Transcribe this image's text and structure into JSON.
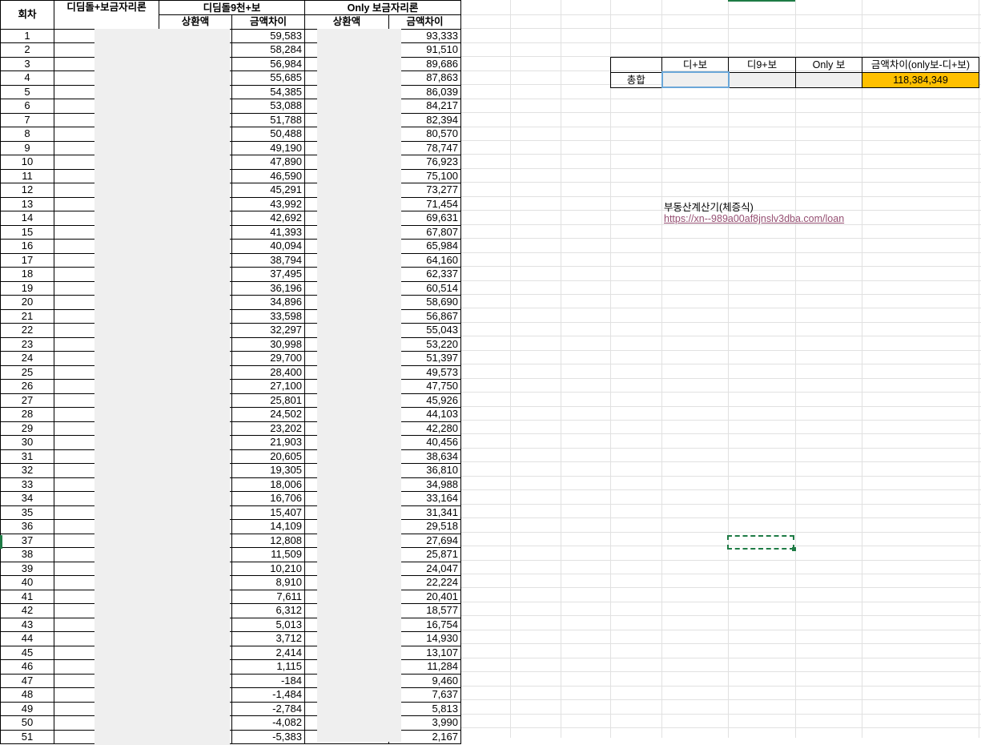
{
  "table": {
    "headers": {
      "round": "회차",
      "didimdol_bogeum": "디딤돌+보금자리론",
      "didimdol9_group": "디딤돌9천+보",
      "only_group": "Only 보금자리론",
      "repay": "상환액",
      "diff": "금액차이",
      "repay2": "상환액",
      "diff2": "금액차이"
    },
    "rows": [
      {
        "n": "1",
        "d": "59,583",
        "o": "93,333"
      },
      {
        "n": "2",
        "d": "58,284",
        "o": "91,510"
      },
      {
        "n": "3",
        "d": "56,984",
        "o": "89,686"
      },
      {
        "n": "4",
        "d": "55,685",
        "o": "87,863"
      },
      {
        "n": "5",
        "d": "54,385",
        "o": "86,039"
      },
      {
        "n": "6",
        "d": "53,088",
        "o": "84,217"
      },
      {
        "n": "7",
        "d": "51,788",
        "o": "82,394"
      },
      {
        "n": "8",
        "d": "50,488",
        "o": "80,570"
      },
      {
        "n": "9",
        "d": "49,190",
        "o": "78,747"
      },
      {
        "n": "10",
        "d": "47,890",
        "o": "76,923"
      },
      {
        "n": "11",
        "d": "46,590",
        "o": "75,100"
      },
      {
        "n": "12",
        "d": "45,291",
        "o": "73,277"
      },
      {
        "n": "13",
        "d": "43,992",
        "o": "71,454"
      },
      {
        "n": "14",
        "d": "42,692",
        "o": "69,631"
      },
      {
        "n": "15",
        "d": "41,393",
        "o": "67,807"
      },
      {
        "n": "16",
        "d": "40,094",
        "o": "65,984"
      },
      {
        "n": "17",
        "d": "38,794",
        "o": "64,160"
      },
      {
        "n": "18",
        "d": "37,495",
        "o": "62,337"
      },
      {
        "n": "19",
        "d": "36,196",
        "o": "60,514"
      },
      {
        "n": "20",
        "d": "34,896",
        "o": "58,690"
      },
      {
        "n": "21",
        "d": "33,598",
        "o": "56,867"
      },
      {
        "n": "22",
        "d": "32,297",
        "o": "55,043"
      },
      {
        "n": "23",
        "d": "30,998",
        "o": "53,220"
      },
      {
        "n": "24",
        "d": "29,700",
        "o": "51,397"
      },
      {
        "n": "25",
        "d": "28,400",
        "o": "49,573"
      },
      {
        "n": "26",
        "d": "27,100",
        "o": "47,750"
      },
      {
        "n": "27",
        "d": "25,801",
        "o": "45,926"
      },
      {
        "n": "28",
        "d": "24,502",
        "o": "44,103"
      },
      {
        "n": "29",
        "d": "23,202",
        "o": "42,280"
      },
      {
        "n": "30",
        "d": "21,903",
        "o": "40,456"
      },
      {
        "n": "31",
        "d": "20,605",
        "o": "38,634"
      },
      {
        "n": "32",
        "d": "19,305",
        "o": "36,810"
      },
      {
        "n": "33",
        "d": "18,006",
        "o": "34,988"
      },
      {
        "n": "34",
        "d": "16,706",
        "o": "33,164"
      },
      {
        "n": "35",
        "d": "15,407",
        "o": "31,341"
      },
      {
        "n": "36",
        "d": "14,109",
        "o": "29,518"
      },
      {
        "n": "37",
        "d": "12,808",
        "o": "27,694"
      },
      {
        "n": "38",
        "d": "11,509",
        "o": "25,871"
      },
      {
        "n": "39",
        "d": "10,210",
        "o": "24,047"
      },
      {
        "n": "40",
        "d": "8,910",
        "o": "22,224"
      },
      {
        "n": "41",
        "d": "7,611",
        "o": "20,401"
      },
      {
        "n": "42",
        "d": "6,312",
        "o": "18,577"
      },
      {
        "n": "43",
        "d": "5,013",
        "o": "16,754"
      },
      {
        "n": "44",
        "d": "3,712",
        "o": "14,930"
      },
      {
        "n": "45",
        "d": "2,414",
        "o": "13,107"
      },
      {
        "n": "46",
        "d": "1,115",
        "o": "11,284"
      },
      {
        "n": "47",
        "d": "-184",
        "o": "9,460"
      },
      {
        "n": "48",
        "d": "-1,484",
        "o": "7,637"
      },
      {
        "n": "49",
        "d": "-2,784",
        "o": "5,813"
      },
      {
        "n": "50",
        "d": "-4,082",
        "o": "3,990"
      },
      {
        "n": "51",
        "d": "-5,383",
        "o": "2,167"
      }
    ]
  },
  "summary": {
    "headers": [
      "디+보",
      "디9+보",
      "Only 보",
      "금액차이(only보-디+보)"
    ],
    "row_label": "총합",
    "total": "118,384,349"
  },
  "note": {
    "title": "부동산계산기(체증식)",
    "link": "https://xn--989a00af8jnslv3dba.com/loan"
  },
  "colors": {
    "highlight": "#ffc000",
    "active_cell": "#1e7b45",
    "link": "#954f72",
    "mask": "#efefef"
  }
}
